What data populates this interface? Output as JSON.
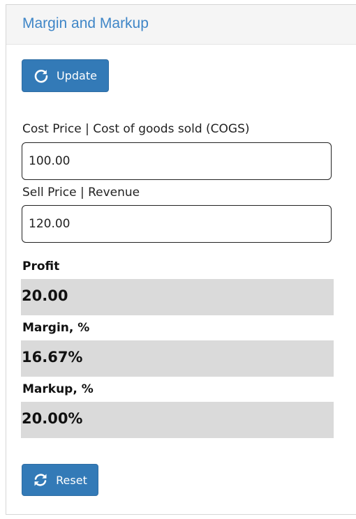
{
  "panel": {
    "title": "Margin and Markup"
  },
  "buttons": {
    "update_label": "Update",
    "update_icon": "refresh-icon",
    "reset_label": "Reset",
    "reset_icon": "sync-icon"
  },
  "form": {
    "cost_label": "Cost Price | Cost of goods sold (COGS)",
    "cost_value": "100.00",
    "sell_label": "Sell Price | Revenue",
    "sell_value": "120.00"
  },
  "results": {
    "profit_label": "Profit",
    "profit_value": "20.00",
    "margin_label": "Margin, %",
    "margin_value": "16.67%",
    "markup_label": "Markup, %",
    "markup_value": "20.00%"
  },
  "colors": {
    "accent": "#337ab7",
    "title": "#3f86c7",
    "result_bg": "#dadada"
  }
}
